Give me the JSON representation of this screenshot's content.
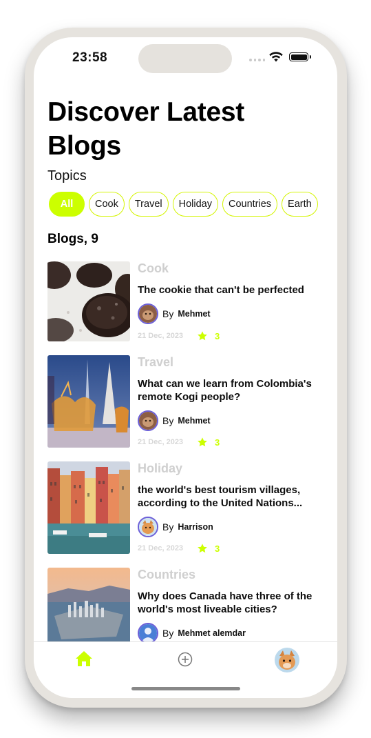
{
  "status_bar": {
    "time": "23:58"
  },
  "header": {
    "title": "Discover Latest Blogs",
    "topics_label": "Topics"
  },
  "topics": [
    "All",
    "Cook",
    "Travel",
    "Holiday",
    "Countries",
    "Earth"
  ],
  "selected_topic": "All",
  "blogs_heading": "Blogs, 9",
  "blogs": [
    {
      "category": "Cook",
      "title": "The cookie that can't be perfected",
      "by": "By",
      "author": "Mehmet",
      "date": "21 Dec, 2023",
      "rating": "3"
    },
    {
      "category": "Travel",
      "title": "What can we learn from Colombia's remote Kogi people?",
      "by": "By",
      "author": "Mehmet",
      "date": "21 Dec, 2023",
      "rating": "3"
    },
    {
      "category": "Holiday",
      "title": " the world's best tourism villages, according to the United Nations...",
      "by": "By",
      "author": "Harrison",
      "date": "21 Dec, 2023",
      "rating": "3"
    },
    {
      "category": "Countries",
      "title": "Why does Canada have three of the world's most liveable cities?",
      "by": "By",
      "author": "Mehmet alemdar"
    }
  ],
  "tabbar": {
    "items": [
      "home-icon",
      "add-icon",
      "profile-avatar"
    ],
    "active": "home-icon"
  },
  "colors": {
    "accent": "#ccff00",
    "muted_text": "#cfcfcf",
    "avatar_ring": "#6b5fd8",
    "frame": "#e6e3de"
  }
}
